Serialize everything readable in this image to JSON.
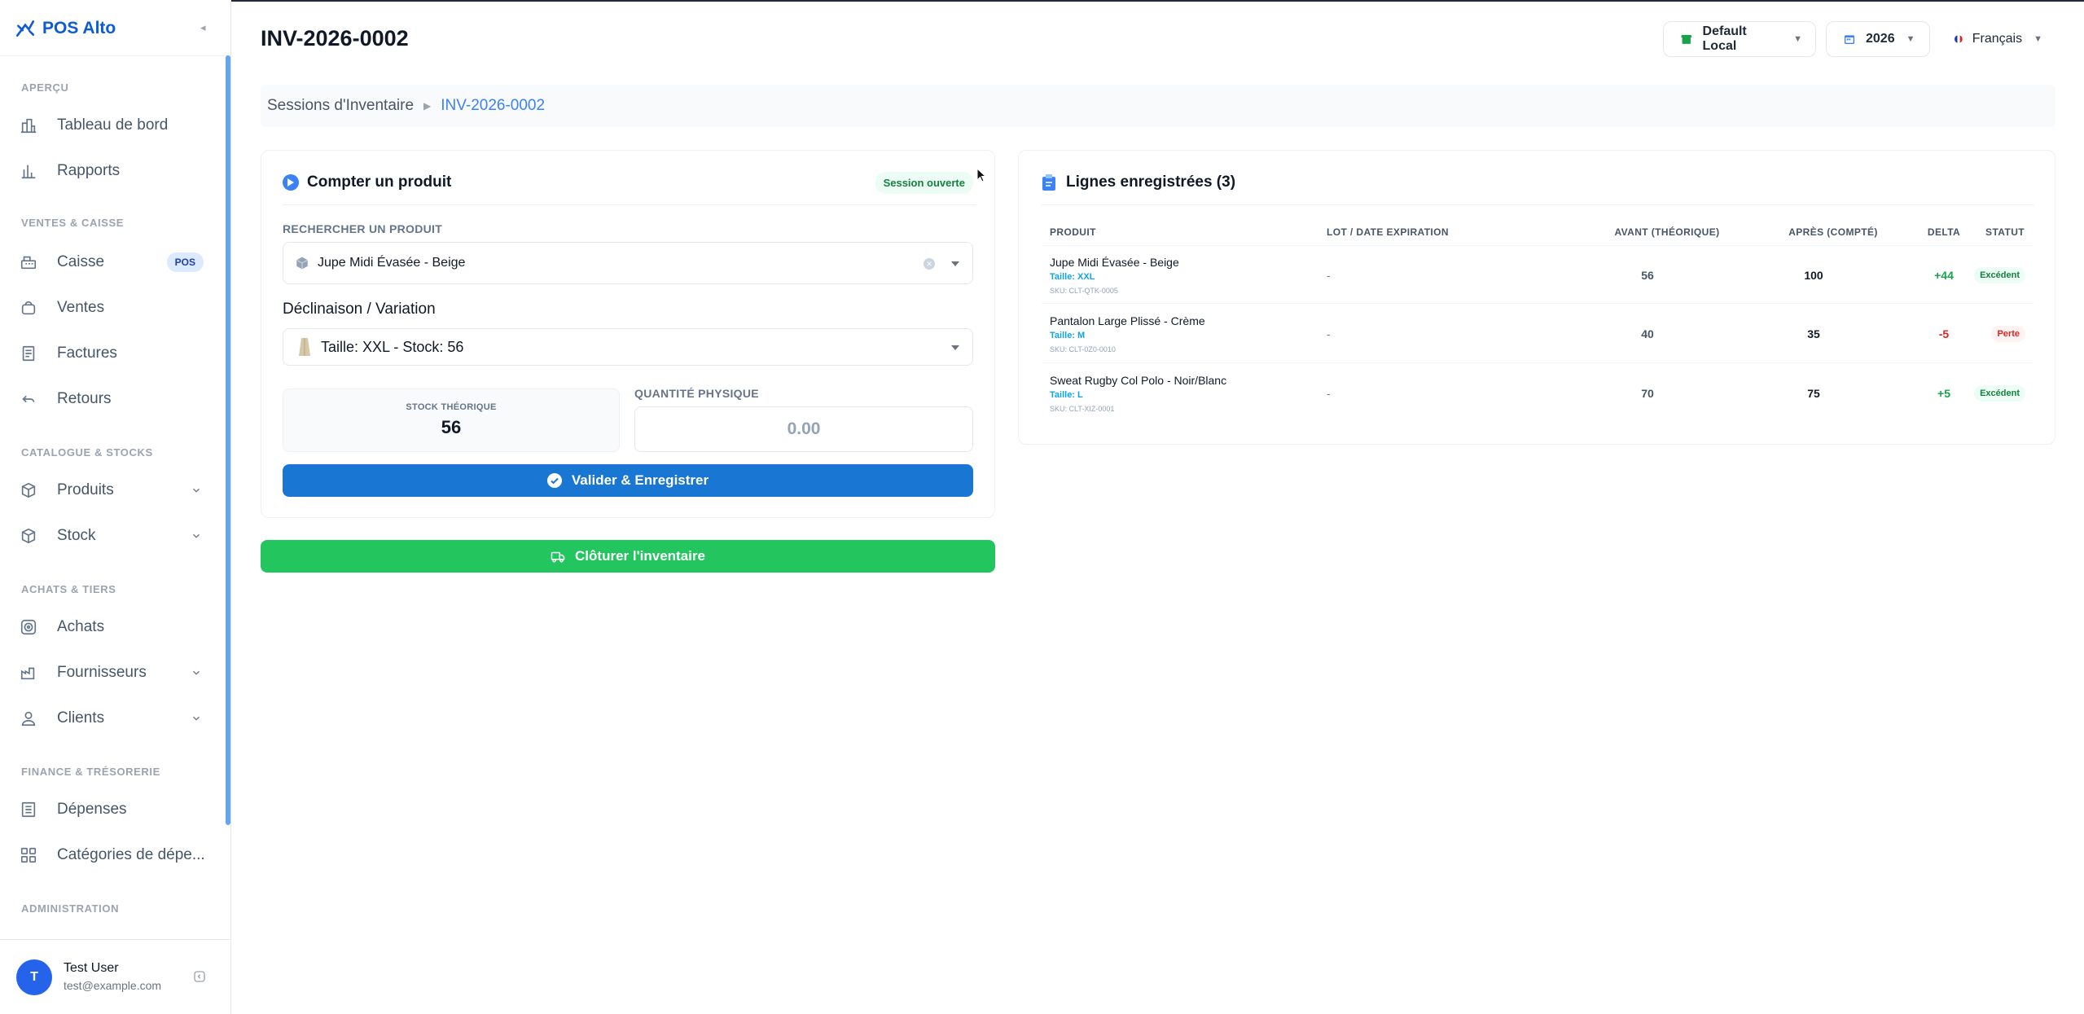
{
  "sidebar": {
    "brand": "POS Alto",
    "sections": {
      "apercu": "APERÇU",
      "ventes": "VENTES & CAISSE",
      "catalogue": "CATALOGUE & STOCKS",
      "achats": "ACHATS & TIERS",
      "finance": "FINANCE & TRÉSORERIE",
      "admin": "ADMINISTRATION"
    },
    "items": {
      "dashboard": "Tableau de bord",
      "rapports": "Rapports",
      "caisse": "Caisse",
      "caisse_badge": "POS",
      "ventes": "Ventes",
      "factures": "Factures",
      "retours": "Retours",
      "produits": "Produits",
      "stock": "Stock",
      "achats": "Achats",
      "fournisseurs": "Fournisseurs",
      "clients": "Clients",
      "depenses": "Dépenses",
      "categories": "Catégories de dépe..."
    },
    "user": {
      "initial": "T",
      "name": "Test User",
      "email": "test@example.com"
    }
  },
  "header": {
    "title": "INV-2026-0002",
    "store": "Default Local",
    "year": "2026",
    "language": "Français"
  },
  "breadcrumb": {
    "parent": "Sessions d'Inventaire",
    "current": "INV-2026-0002"
  },
  "count_card": {
    "title": "Compter un produit",
    "status_badge": "Session ouverte",
    "search_label": "RECHERCHER UN PRODUIT",
    "search_value": "Jupe Midi Évasée - Beige",
    "variation_label": "Déclinaison / Variation",
    "variation_value": "Taille: XXL - Stock: 56",
    "theoretical_label": "STOCK THÉORIQUE",
    "theoretical_value": "56",
    "physical_label": "QUANTITÉ PHYSIQUE",
    "physical_placeholder": "0.00",
    "validate_button": "Valider & Enregistrer",
    "close_button": "Clôturer l'inventaire"
  },
  "lines_card": {
    "title": "Lignes enregistrées (3)",
    "columns": [
      "PRODUIT",
      "LOT / DATE EXPIRATION",
      "AVANT (THÉORIQUE)",
      "APRÈS (COMPTÉ)",
      "DELTA",
      "STATUT"
    ],
    "rows": [
      {
        "product": "Jupe Midi Évasée - Beige",
        "size": "Taille: XXL",
        "sku": "SKU: CLT-QTK-0005",
        "lot": "-",
        "before": "56",
        "after": "100",
        "delta": "+44",
        "status": "Excédent"
      },
      {
        "product": "Pantalon Large Plissé - Crème",
        "size": "Taille: M",
        "sku": "SKU: CLT-0Z0-0010",
        "lot": "-",
        "before": "40",
        "after": "35",
        "delta": "-5",
        "status": "Perte"
      },
      {
        "product": "Sweat Rugby Col Polo - Noir/Blanc",
        "size": "Taille: L",
        "sku": "SKU: CLT-XIZ-0001",
        "lot": "-",
        "before": "70",
        "after": "75",
        "delta": "+5",
        "status": "Excédent"
      }
    ]
  }
}
